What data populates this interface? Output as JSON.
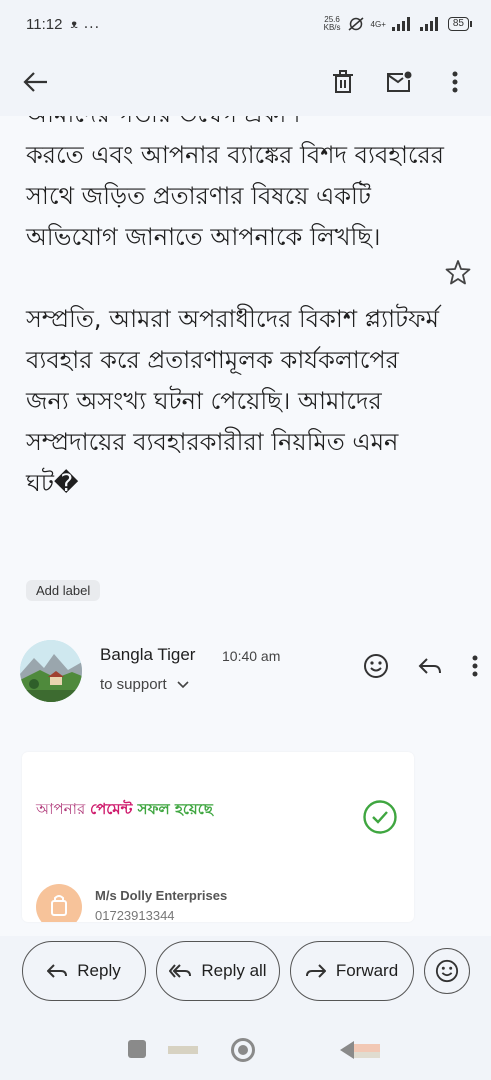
{
  "status_bar": {
    "time": "11:12",
    "notification_glyph": "ᴥ",
    "overflow": "...",
    "speed_value": "25.6",
    "speed_unit": "KB/s",
    "network": "4G+",
    "battery": "85"
  },
  "toolbar": {
    "back_icon": "arrow-back-icon",
    "actions": [
      "delete-icon",
      "mark-unread-icon",
      "more-icon"
    ]
  },
  "email_body": {
    "partial_top_line": "আমাদের গভীর উদ্বেগ প্রকাশ",
    "paragraph1": "করতে এবং আপনার ব্যাঙ্কের বিশদ ব্যবহারের সাথে জড়িত প্রতারণার বিষয়ে একটি অভিযোগ জানাতে আপনাকে লিখছি।",
    "paragraph2": "সম্প্রতি, আমরা অপরাধীদের বিকাশ প্ল্যাটফর্ম ব্যবহার করে প্রতারণামূলক কার্যকলাপের জন্য অসংখ্য ঘটনা পেয়েছি। আমাদের সম্প্রদায়ের ব্যবহারকারীরা নিয়মিত এমন ঘট�"
  },
  "label_chip": "Add label",
  "message": {
    "sender_name": "Bangla Tiger",
    "time": "10:40 am",
    "recipient": "to support"
  },
  "receipt_card": {
    "title_part1": "আপনার ",
    "title_part2": "পেমেন্ট",
    "title_part3": " সফল হয়েছে",
    "merchant_name": "M/s Dolly Enterprises",
    "merchant_phone": "01723913344"
  },
  "bottom_actions": {
    "reply": "Reply",
    "reply_all": "Reply all",
    "forward": "Forward"
  },
  "colors": {
    "background": "#f1f4f9",
    "content_bg": "#f7f9fc",
    "check_green": "#3fa640",
    "pink": "#cf1b6d"
  }
}
